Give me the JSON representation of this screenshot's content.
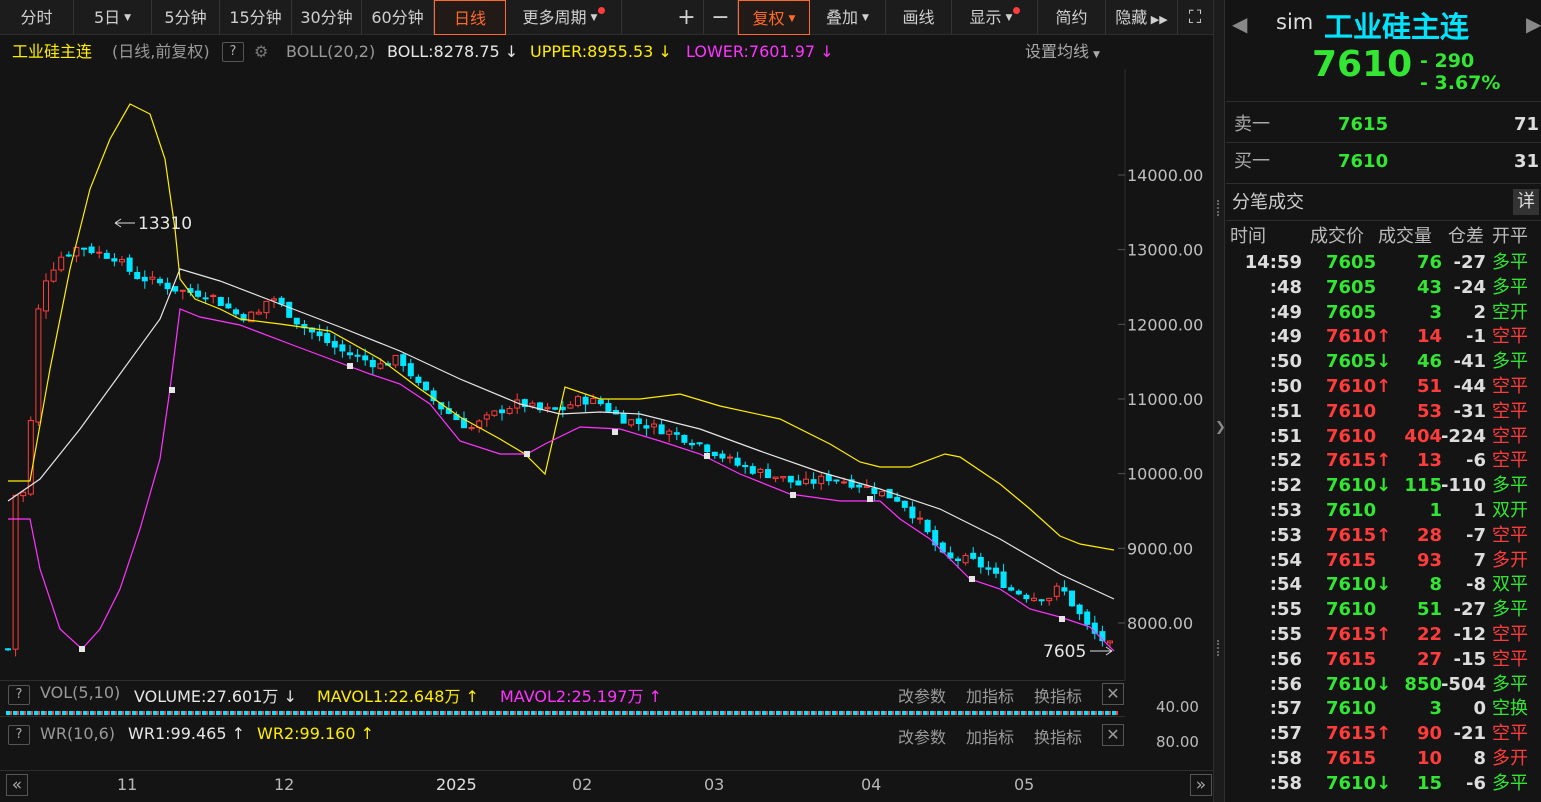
{
  "toolbar": {
    "items": [
      "分时",
      "5日",
      "5分钟",
      "15分钟",
      "30分钟",
      "60分钟",
      "日线",
      "更多周期",
      "+",
      "−",
      "复权",
      "叠加",
      "画线",
      "显示",
      "简约",
      "隐藏"
    ],
    "active": "日线"
  },
  "indicator_header": {
    "name": "工业硅主连",
    "mode": "(日线,前复权)",
    "boll": "BOLL(20,2)",
    "boll_value": "BOLL:8278.75",
    "upper": "UPPER:8955.53",
    "lower": "LOWER:7601.97",
    "settings": "设置均线"
  },
  "chart_data": {
    "type": "candlestick",
    "y_ticks": [
      "14000.00",
      "13000.00",
      "12000.00",
      "11000.00",
      "10000.00",
      "9000.00",
      "8000.00"
    ],
    "x_labels": [
      "11",
      "12",
      "2025",
      "02",
      "03",
      "04",
      "05"
    ],
    "high_marker": "13310",
    "last_marker": "7605",
    "colors": {
      "up": "#ff3c3c",
      "down": "#00e5ff",
      "upper": "#ffee00",
      "mid": "#e6e6e6",
      "lower": "#ff33ff"
    }
  },
  "vol_panel": {
    "title": "VOL(5,10)",
    "volume": "VOLUME:27.601万",
    "mavol1": "MAVOL1:22.648万",
    "mavol2": "MAVOL2:25.197万",
    "btn1": "改参数",
    "btn2": "加指标",
    "btn3": "换指标",
    "axis": "40.00"
  },
  "wr_panel": {
    "title": "WR(10,6)",
    "wr1": "WR1:99.465",
    "wr2": "WR2:99.160",
    "btn1": "改参数",
    "btn2": "加指标",
    "btn3": "换指标",
    "axis": "80.00"
  },
  "quote": {
    "prefix": "sim",
    "name": "工业硅主连",
    "price": "7610",
    "change": "- 290",
    "change_pct": "- 3.67%",
    "ask_label": "卖一",
    "ask_price": "7615",
    "ask_qty": "71",
    "bid_label": "买一",
    "bid_price": "7610",
    "bid_qty": "31"
  },
  "ticks": {
    "title": "分笔成交",
    "detail": "详",
    "headers": [
      "时间",
      "成交价",
      "成交量",
      "仓差",
      "开平"
    ],
    "rows": [
      {
        "t": "14:59",
        "p": "7605",
        "a": "",
        "v": "76",
        "d": "-27",
        "o": "多平",
        "vc": "g",
        "oc": "g"
      },
      {
        "t": ":48",
        "p": "7605",
        "a": "",
        "v": "43",
        "d": "-24",
        "o": "多平",
        "vc": "g",
        "oc": "g"
      },
      {
        "t": ":49",
        "p": "7605",
        "a": "",
        "v": "3",
        "d": "2",
        "o": "空开",
        "vc": "g",
        "oc": "g"
      },
      {
        "t": ":49",
        "p": "7610",
        "a": "↑",
        "v": "14",
        "d": "-1",
        "o": "空平",
        "vc": "r",
        "oc": "r"
      },
      {
        "t": ":50",
        "p": "7605",
        "a": "↓",
        "v": "46",
        "d": "-41",
        "o": "多平",
        "vc": "g",
        "oc": "g"
      },
      {
        "t": ":50",
        "p": "7610",
        "a": "↑",
        "v": "51",
        "d": "-44",
        "o": "空平",
        "vc": "r",
        "oc": "r"
      },
      {
        "t": ":51",
        "p": "7610",
        "a": "",
        "v": "53",
        "d": "-31",
        "o": "空平",
        "vc": "r",
        "oc": "r"
      },
      {
        "t": ":51",
        "p": "7610",
        "a": "",
        "v": "404",
        "d": "-224",
        "o": "空平",
        "vc": "r",
        "oc": "r"
      },
      {
        "t": ":52",
        "p": "7615",
        "a": "↑",
        "v": "13",
        "d": "-6",
        "o": "空平",
        "vc": "r",
        "oc": "r"
      },
      {
        "t": ":52",
        "p": "7610",
        "a": "↓",
        "v": "115",
        "d": "-110",
        "o": "多平",
        "vc": "g",
        "oc": "g"
      },
      {
        "t": ":53",
        "p": "7610",
        "a": "",
        "v": "1",
        "d": "1",
        "o": "双开",
        "vc": "g",
        "oc": "g"
      },
      {
        "t": ":53",
        "p": "7615",
        "a": "↑",
        "v": "28",
        "d": "-7",
        "o": "空平",
        "vc": "r",
        "oc": "r"
      },
      {
        "t": ":54",
        "p": "7615",
        "a": "",
        "v": "93",
        "d": "7",
        "o": "多开",
        "vc": "r",
        "oc": "r"
      },
      {
        "t": ":54",
        "p": "7610",
        "a": "↓",
        "v": "8",
        "d": "-8",
        "o": "双平",
        "vc": "g",
        "oc": "g"
      },
      {
        "t": ":55",
        "p": "7610",
        "a": "",
        "v": "51",
        "d": "-27",
        "o": "多平",
        "vc": "g",
        "oc": "g"
      },
      {
        "t": ":55",
        "p": "7615",
        "a": "↑",
        "v": "22",
        "d": "-12",
        "o": "空平",
        "vc": "r",
        "oc": "r"
      },
      {
        "t": ":56",
        "p": "7615",
        "a": "",
        "v": "27",
        "d": "-15",
        "o": "空平",
        "vc": "r",
        "oc": "r"
      },
      {
        "t": ":56",
        "p": "7610",
        "a": "↓",
        "v": "850",
        "d": "-504",
        "o": "多平",
        "vc": "g",
        "oc": "g"
      },
      {
        "t": ":57",
        "p": "7610",
        "a": "",
        "v": "3",
        "d": "0",
        "o": "空换",
        "vc": "g",
        "oc": "g"
      },
      {
        "t": ":57",
        "p": "7615",
        "a": "↑",
        "v": "90",
        "d": "-21",
        "o": "空平",
        "vc": "r",
        "oc": "r"
      },
      {
        "t": ":58",
        "p": "7615",
        "a": "",
        "v": "10",
        "d": "8",
        "o": "多开",
        "vc": "r",
        "oc": "r"
      },
      {
        "t": ":58",
        "p": "7610",
        "a": "↓",
        "v": "15",
        "d": "-6",
        "o": "多平",
        "vc": "g",
        "oc": "g"
      }
    ]
  }
}
